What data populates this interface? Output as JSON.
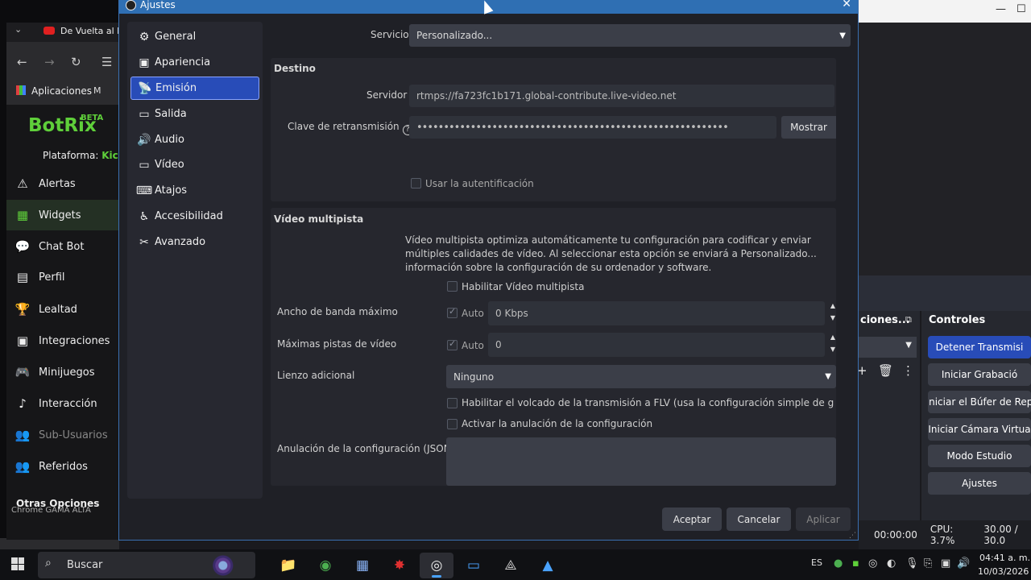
{
  "browser": {
    "tab_title": "De Vuelta al Ba",
    "bookmark_apps": "Aplicaciones",
    "bookmark_m": "M"
  },
  "botrix": {
    "logo": "BotRix",
    "beta": "BETA",
    "platform_label": "Plataforma:",
    "platform_value": "Kick",
    "menu": [
      {
        "label": "Alertas",
        "icon": "warning-icon"
      },
      {
        "label": "Widgets",
        "icon": "widgets-icon"
      },
      {
        "label": "Chat Bot",
        "icon": "chat-icon"
      },
      {
        "label": "Perfil",
        "icon": "profile-icon"
      },
      {
        "label": "Lealtad",
        "icon": "trophy-icon"
      },
      {
        "label": "Integraciones",
        "icon": "integrations-icon"
      },
      {
        "label": "Minijuegos",
        "icon": "gamepad-icon"
      },
      {
        "label": "Interacción",
        "icon": "music-icon"
      },
      {
        "label": "Sub-Usuarios",
        "icon": "sub-users-icon"
      },
      {
        "label": "Referidos",
        "icon": "referrals-icon"
      }
    ],
    "other_options": "Otras Opciones",
    "other_sub": "Chrome    GAMA ALTA"
  },
  "dialog": {
    "title": "Ajustes",
    "nav": [
      {
        "label": "General",
        "icon": "gear-icon"
      },
      {
        "label": "Apariencia",
        "icon": "appearance-icon"
      },
      {
        "label": "Emisión",
        "icon": "broadcast-icon"
      },
      {
        "label": "Salida",
        "icon": "output-icon"
      },
      {
        "label": "Audio",
        "icon": "speaker-icon"
      },
      {
        "label": "Vídeo",
        "icon": "monitor-icon"
      },
      {
        "label": "Atajos",
        "icon": "keyboard-icon"
      },
      {
        "label": "Accesibilidad",
        "icon": "accessibility-icon"
      },
      {
        "label": "Avanzado",
        "icon": "tools-icon"
      }
    ],
    "selected_nav": "Emisión",
    "service_label": "Servicio",
    "service_value": "Personalizado...",
    "destino": {
      "title": "Destino",
      "server_label": "Servidor",
      "server_value": "rtmps://fa723fc1b171.global-contribute.live-video.net",
      "key_label": "Clave de retransmisión",
      "key_value": "••••••••••••••••••••••••••••••••••••••••••••••••••••••••••",
      "show_button": "Mostrar",
      "auth_label": "Usar la autentificación",
      "auth_checked": false
    },
    "multitrack": {
      "title": "Vídeo multipista",
      "description": "Vídeo multipista optimiza automáticamente tu configuración para codificar y enviar múltiples calidades de vídeo. Al seleccionar esta opción se enviará a Personalizado... información sobre la configuración de su ordenador y software.",
      "enable_label": "Habilitar Vídeo multipista",
      "enable_checked": false,
      "bandwidth_label": "Ancho de banda máximo",
      "bandwidth_auto": "Auto",
      "bandwidth_value": "0 Kbps",
      "tracks_label": "Máximas pistas de vídeo",
      "tracks_auto": "Auto",
      "tracks_value": "0",
      "canvas_label": "Lienzo adicional",
      "canvas_value": "Ninguno",
      "flv_label": "Habilitar el volcado de la transmisión a FLV (usa la configuración simple de grabació",
      "override_label": "Activar la anulación de la configuración",
      "override_json_label": "Anulación de la configuración (JSON)"
    },
    "buttons": {
      "accept": "Aceptar",
      "cancel": "Cancelar",
      "apply": "Aplicar"
    }
  },
  "obs": {
    "scenes_title": "ciones...",
    "controls_title": "Controles",
    "controls": [
      "Detener Transmisi",
      "Iniciar Grabació",
      "Iniciar el Búfer de Rep",
      "Iniciar Cámara Virtua",
      "Modo Estudio",
      "Ajustes"
    ],
    "status_time": "00:00:00",
    "status_cpu": "CPU: 3.7%",
    "status_fps": "30.00 / 30.0"
  },
  "taskbar": {
    "search_placeholder": "Buscar",
    "lang": "ES",
    "time": "04:41 a. m.",
    "date": "10/03/2026"
  },
  "colors": {
    "accent": "#284cb8",
    "titlebar": "#2f6fb3",
    "botrix_green": "#5fcf3a"
  }
}
